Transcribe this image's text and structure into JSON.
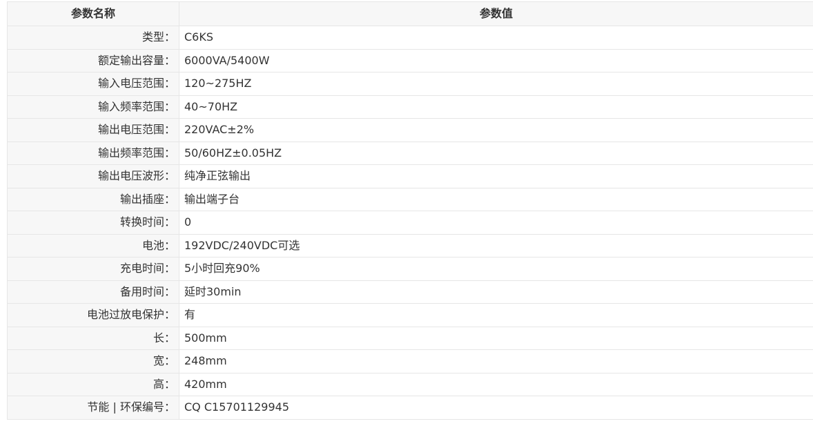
{
  "header": {
    "name_label": "参数名称",
    "value_label": "参数值"
  },
  "rows": [
    {
      "name": "类型：",
      "value": "C6KS"
    },
    {
      "name": "额定输出容量：",
      "value": "6000VA/5400W"
    },
    {
      "name": "输入电压范围：",
      "value": "120~275HZ"
    },
    {
      "name": "输入频率范围：",
      "value": "40~70HZ"
    },
    {
      "name": "输出电压范围：",
      "value": "220VAC±2%"
    },
    {
      "name": "输出频率范围：",
      "value": "50/60HZ±0.05HZ"
    },
    {
      "name": "输出电压波形：",
      "value": "纯净正弦输出"
    },
    {
      "name": "输出插座：",
      "value": "输出端子台"
    },
    {
      "name": "转换时间：",
      "value": "0"
    },
    {
      "name": "电池：",
      "value": "192VDC/240VDC可选"
    },
    {
      "name": "充电时间：",
      "value": "5小时回充90%"
    },
    {
      "name": "备用时间：",
      "value": "延时30min"
    },
    {
      "name": "电池过放电保护：",
      "value": "有"
    },
    {
      "name": "长：",
      "value": "500mm"
    },
    {
      "name": "宽：",
      "value": "248mm"
    },
    {
      "name": "高：",
      "value": "420mm"
    },
    {
      "name": "节能 | 环保编号：",
      "value": "CQ C15701129945"
    }
  ]
}
